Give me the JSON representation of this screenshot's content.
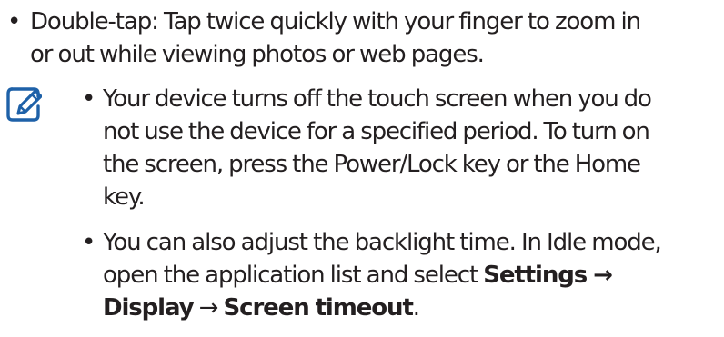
{
  "main_bullet": {
    "marker": "•",
    "lines": [
      "Double-tap: Tap twice quickly with your finger to zoom in",
      "or out while viewing photos or web pages."
    ]
  },
  "note": {
    "icon": "note-pencil-icon",
    "icon_color": "#1e61a8",
    "items": [
      {
        "marker": "•",
        "lines": [
          "Your device turns off the touch screen when you do",
          "not use the device for a specified period. To turn on",
          "the screen, press the Power/Lock key or the Home",
          "key."
        ]
      },
      {
        "marker": "•",
        "line1": "You can also adjust the backlight time. In Idle mode,",
        "line2_prefix": "open the application list and select ",
        "line2_bold": "Settings →",
        "line3_bold_a": "Display",
        "line3_arrow": " → ",
        "line3_bold_b": "Screen timeout",
        "line3_suffix": "."
      }
    ]
  }
}
